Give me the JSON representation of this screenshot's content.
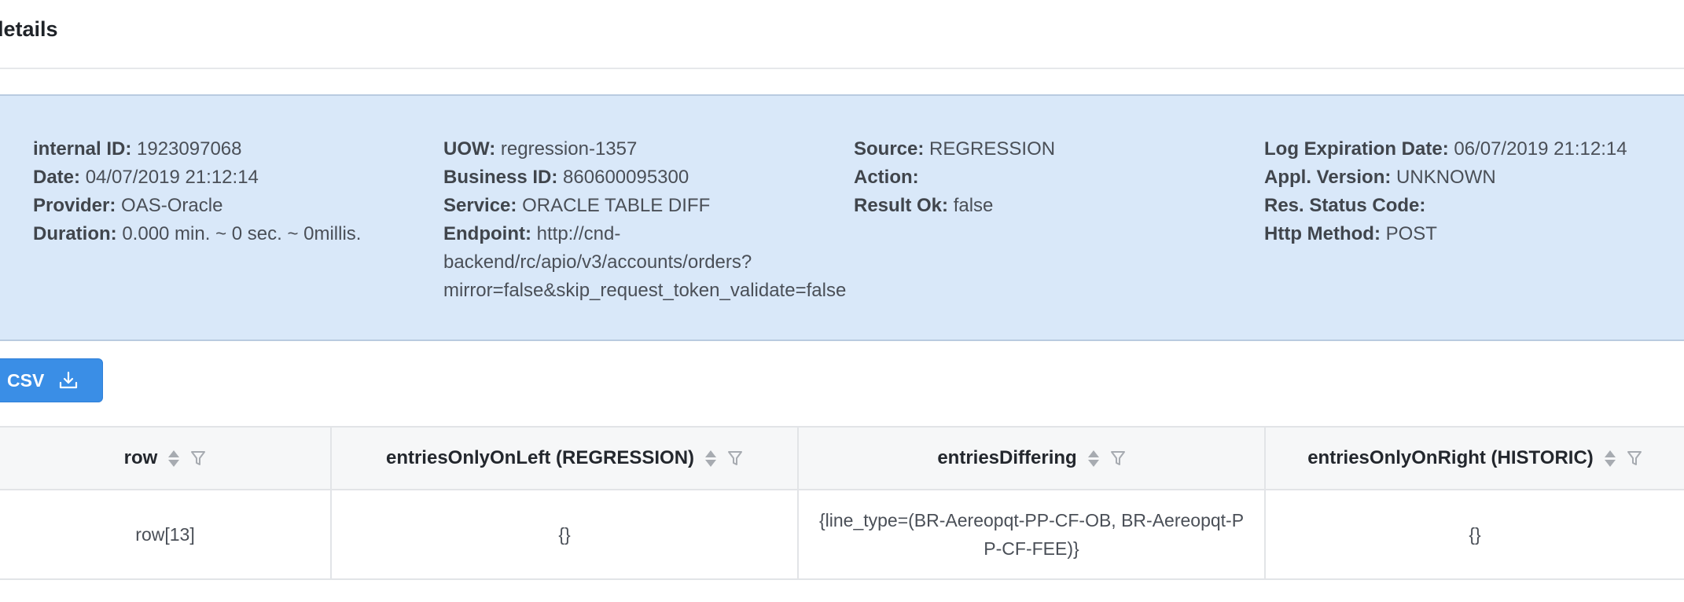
{
  "page": {
    "title": "g details"
  },
  "info": {
    "internal_id": {
      "label": "internal ID:",
      "value": "1923097068"
    },
    "date": {
      "label": "Date:",
      "value": "04/07/2019 21:12:14"
    },
    "provider": {
      "label": "Provider:",
      "value": "OAS-Oracle"
    },
    "duration": {
      "label": "Duration:",
      "value": "0.000 min. ~ 0 sec. ~ 0millis."
    },
    "uow": {
      "label": "UOW:",
      "value": "regression-1357"
    },
    "business_id": {
      "label": "Business ID:",
      "value": "860600095300"
    },
    "service": {
      "label": "Service:",
      "value": "ORACLE TABLE DIFF"
    },
    "endpoint": {
      "label": "Endpoint:",
      "value": "http://cnd-backend/rc/apio/v3/accounts/orders?mirror=false&skip_request_token_validate=false"
    },
    "source": {
      "label": "Source:",
      "value": "REGRESSION"
    },
    "action": {
      "label": "Action:",
      "value": ""
    },
    "result_ok": {
      "label": "Result Ok:",
      "value": "false"
    },
    "log_expiration": {
      "label": "Log Expiration Date:",
      "value": "06/07/2019 21:12:14"
    },
    "appl_version": {
      "label": "Appl. Version:",
      "value": "UNKNOWN"
    },
    "res_status_code": {
      "label": "Res. Status Code:",
      "value": ""
    },
    "http_method": {
      "label": "Http Method:",
      "value": "POST"
    }
  },
  "toolbar": {
    "csv_label": "CSV",
    "download_icon": "download-icon"
  },
  "table": {
    "columns": [
      {
        "label": "row"
      },
      {
        "label": "entriesOnlyOnLeft (REGRESSION)"
      },
      {
        "label": "entriesDiffering"
      },
      {
        "label": "entriesOnlyOnRight (HISTORIC)"
      }
    ],
    "rows": [
      [
        "row[13]",
        "{}",
        "{line_type=(BR-Aereopqt-PP-CF-OB, BR-Aereopqt-PP-CF-FEE)}",
        "{}"
      ]
    ]
  },
  "colors": {
    "info_panel_bg": "#d9e8f9",
    "primary_button": "#3a8ee6",
    "table_header_bg": "#f6f7f8"
  }
}
